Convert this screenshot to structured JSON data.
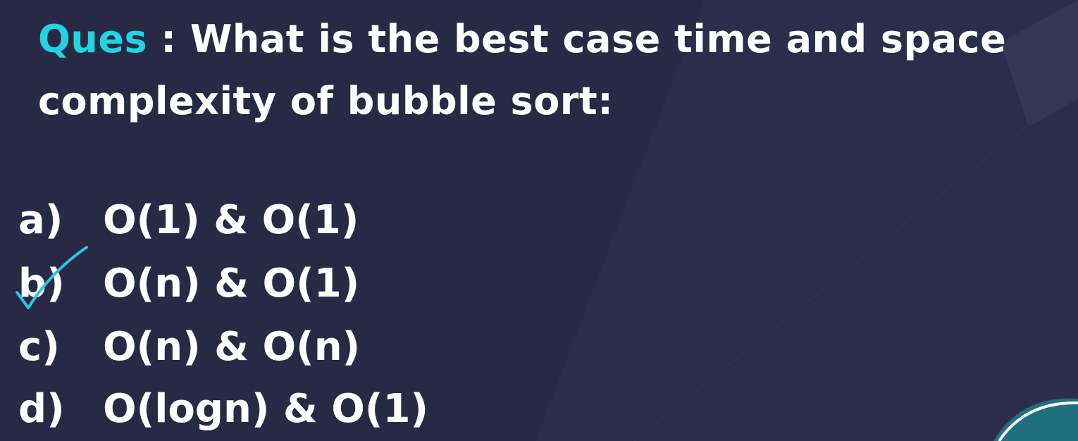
{
  "question": {
    "prefix": "Ques",
    "text": " : What is the best case time and space complexity of bubble sort:"
  },
  "options": [
    {
      "letter": "a)",
      "text": "O(1) & O(1)"
    },
    {
      "letter": "b)",
      "text": "O(n) & O(1)"
    },
    {
      "letter": "c)",
      "text": "O(n) & O(n)"
    },
    {
      "letter": "d)",
      "text": "O(logn) & O(1)"
    }
  ],
  "colors": {
    "background": "#282a45",
    "accent": "#22d3e0",
    "text": "#ffffff",
    "check": "#2ec4e8"
  }
}
